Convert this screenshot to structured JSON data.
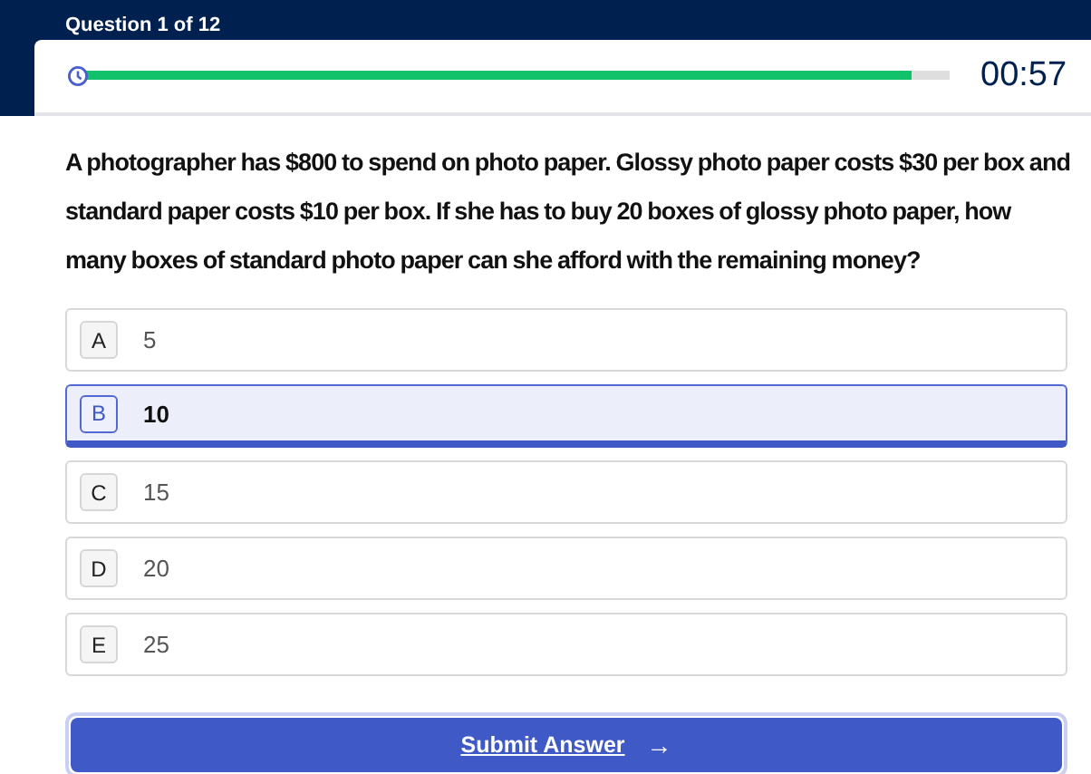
{
  "header": {
    "title": "Question 1 of 12"
  },
  "timer": {
    "level": 0.955,
    "time": "00:57"
  },
  "question": "A photographer has $800 to spend on photo paper. Glossy photo paper costs $30 per box and standard paper costs $10 per box. If she has to buy 20 boxes of glossy photo paper, how many boxes of standard photo paper can she afford with the remaining money?",
  "options": [
    {
      "letter": "A",
      "text": "5",
      "selected": false
    },
    {
      "letter": "B",
      "text": "10",
      "selected": true
    },
    {
      "letter": "C",
      "text": "15",
      "selected": false
    },
    {
      "letter": "D",
      "text": "20",
      "selected": false
    },
    {
      "letter": "E",
      "text": "25",
      "selected": false
    }
  ],
  "submit": {
    "label": "Submit Answer",
    "arrow": "→"
  }
}
